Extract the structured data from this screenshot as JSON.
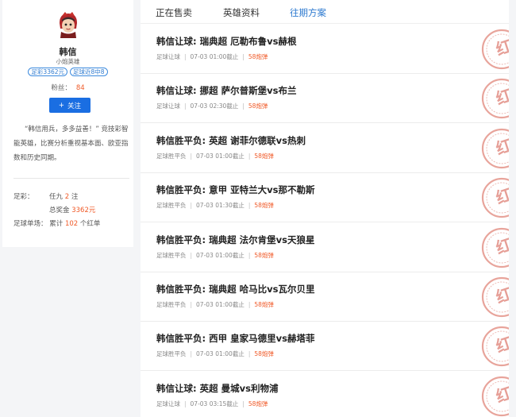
{
  "profile": {
    "name": "韩信",
    "subtitle": "小炮英雄",
    "badges": [
      "足彩3362元",
      "足球近8中8"
    ],
    "fans_label": "粉丝：",
    "fans_count": "84",
    "follow_label": "关注",
    "intro": "“韩信用兵，多多益善！” 竞技彩智能英雄，比赛分析重视基本面、欧亚指数和历史同期。"
  },
  "stats": {
    "zucai_label": "足彩：",
    "renjiu_label": "任九",
    "renjiu_count": "2",
    "renjiu_unit": "注",
    "prize_label": "总奖金",
    "prize_value": "3362元",
    "danchang_label": "足球单场：",
    "danchang_prefix": "累计",
    "danchang_count": "102",
    "danchang_unit": "个红单"
  },
  "tabs": [
    {
      "label": "正在售卖",
      "active": false
    },
    {
      "label": "英雄资料",
      "active": false
    },
    {
      "label": "往期方案",
      "active": true
    }
  ],
  "plans": [
    {
      "title": "韩信让球: 瑞典超 厄勒布鲁vs赫根",
      "type": "足球让球",
      "time": "07-03 01:00截止",
      "price": "58炮弹"
    },
    {
      "title": "韩信让球: 挪超 萨尔普斯堡vs布兰",
      "type": "足球让球",
      "time": "07-03 02:30截止",
      "price": "58炮弹"
    },
    {
      "title": "韩信胜平负: 英超 谢菲尔德联vs热刺",
      "type": "足球胜平负",
      "time": "07-03 01:00截止",
      "price": "58炮弹"
    },
    {
      "title": "韩信胜平负: 意甲 亚特兰大vs那不勒斯",
      "type": "足球胜平负",
      "time": "07-03 01:30截止",
      "price": "58炮弹"
    },
    {
      "title": "韩信胜平负: 瑞典超 法尔肯堡vs天狼星",
      "type": "足球胜平负",
      "time": "07-03 01:00截止",
      "price": "58炮弹"
    },
    {
      "title": "韩信胜平负: 瑞典超 哈马比vs瓦尔贝里",
      "type": "足球胜平负",
      "time": "07-03 01:00截止",
      "price": "58炮弹"
    },
    {
      "title": "韩信胜平负: 西甲 皇家马德里vs赫塔菲",
      "type": "足球胜平负",
      "time": "07-03 01:00截止",
      "price": "58炮弹"
    },
    {
      "title": "韩信让球: 英超 曼城vs利物浦",
      "type": "足球让球",
      "time": "07-03 03:15截止",
      "price": "58炮弹"
    }
  ],
  "stamp_text": "红",
  "colors": {
    "accent": "#2f7bd0",
    "button": "#1a6ee2",
    "highlight": "#f05a28",
    "stamp": "#e0857a"
  }
}
